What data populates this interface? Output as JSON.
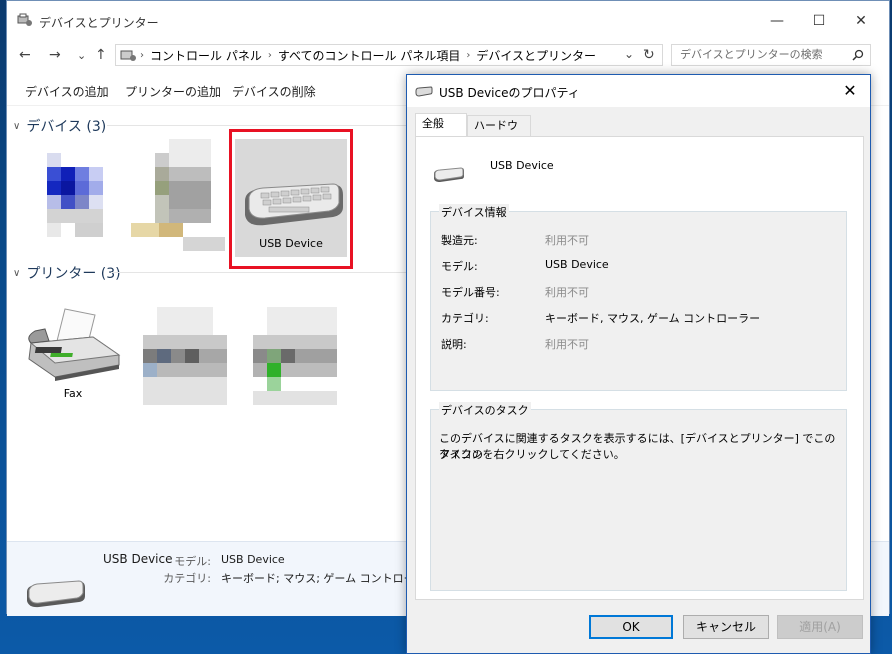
{
  "window": {
    "title": "デバイスとプリンター",
    "minimize": "—",
    "maximize": "☐",
    "close": "✕"
  },
  "address": {
    "back": "←",
    "forward": "→",
    "up": "↑",
    "segments": [
      "コントロール パネル",
      "すべてのコントロール パネル項目",
      "デバイスとプリンター"
    ],
    "dropdown": "⌄",
    "refresh": "↻"
  },
  "search": {
    "placeholder": "デバイスとプリンターの検索",
    "icon": "🔍"
  },
  "toolbar": {
    "add_device": "デバイスの追加",
    "add_printer": "プリンターの追加",
    "remove_device": "デバイスの削除"
  },
  "groups": {
    "devices": {
      "label": "デバイス (3)"
    },
    "printers": {
      "label": "プリンター (3)"
    }
  },
  "tiles": {
    "usb_device": "USB Device",
    "fax": "Fax"
  },
  "details": {
    "name": "USB Device",
    "model_label": "モデル:",
    "model_value": "USB Device",
    "category_label": "カテゴリ:",
    "category_value": "キーボード; マウス; ゲーム コントローラー"
  },
  "dialog": {
    "title": "USB Deviceのプロパティ",
    "close": "✕",
    "tabs": [
      "全般",
      "ハードウェア"
    ],
    "device_name": "USB Device",
    "info_legend": "デバイス情報",
    "rows": [
      {
        "label": "製造元:",
        "value": "利用不可",
        "muted": true
      },
      {
        "label": "モデル:",
        "value": "USB Device",
        "muted": false
      },
      {
        "label": "モデル番号:",
        "value": "利用不可",
        "muted": true
      },
      {
        "label": "カテゴリ:",
        "value": "キーボード, マウス, ゲーム コントローラー",
        "muted": false
      },
      {
        "label": "説明:",
        "value": "利用不可",
        "muted": true
      }
    ],
    "task_legend": "デバイスのタスク",
    "task_text_1": "このデバイスに関連するタスクを表示するには、[デバイスとプリンター] でこのタスクの",
    "task_text_2": "アイコンを右クリックしてください。",
    "ok": "OK",
    "cancel": "キャンセル",
    "apply": "適用(A)"
  },
  "colors": {
    "accent": "#0078d7",
    "selection_frame": "#e81123",
    "group_header": "#1e395b"
  }
}
